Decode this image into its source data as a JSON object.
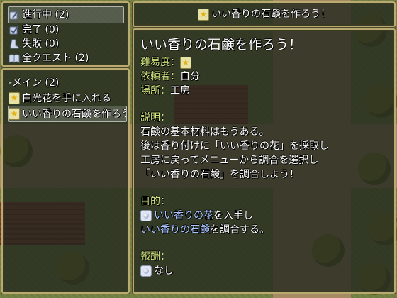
{
  "categories": [
    {
      "label": "進行中 (2)",
      "icon": "quill-scroll-icon",
      "selected": true
    },
    {
      "label": "完了 (0)",
      "icon": "quill-check-icon",
      "selected": false
    },
    {
      "label": "失敗 (0)",
      "icon": "boot-icon",
      "selected": false
    },
    {
      "label": "全クエスト (2)",
      "icon": "book-icon",
      "selected": false
    }
  ],
  "quest_list": {
    "group_label": "-メイン (2)",
    "items": [
      {
        "label": "白光花を手に入れる",
        "selected": false
      },
      {
        "label": "いい香りの石鹸を作ろう！",
        "selected": true
      }
    ]
  },
  "header": {
    "title": "いい香りの石鹸を作ろう！"
  },
  "detail": {
    "title": "いい香りの石鹸を作ろう！",
    "difficulty_label": "難易度：",
    "client_label": "依頼者：",
    "client_value": "自分",
    "place_label": "場所：",
    "place_value": "工房",
    "description_label": "説明：",
    "description_lines": [
      "石鹸の基本材料はもうある。",
      "後は香り付けに「いい香りの花」を採取し",
      "工房に戻ってメニューから調合を選択し",
      "「いい香りの石鹸」を調合しよう！"
    ],
    "objective_label": "目的：",
    "objective_1_hl": "いい香りの花",
    "objective_1_rest": "を入手し",
    "objective_2_hl": "いい香りの石鹸",
    "objective_2_rest": "を調合する。",
    "reward_label": "報酬：",
    "reward_value": "なし"
  },
  "colors": {
    "label": "#cfe37e",
    "highlight": "#a7c4ff",
    "frame": "#b9aa72"
  }
}
